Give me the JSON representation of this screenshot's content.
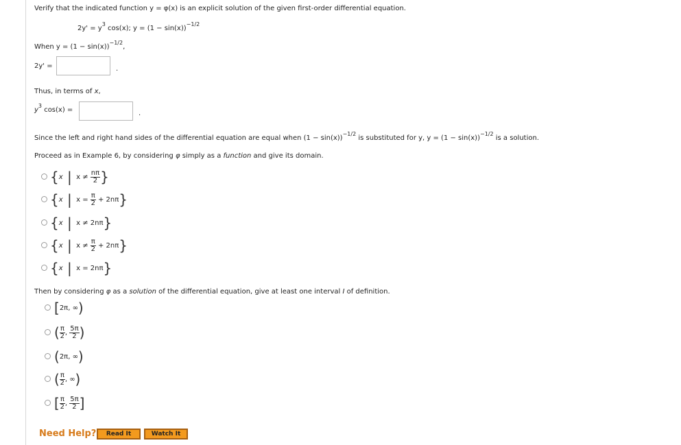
{
  "problem": {
    "statement": "Verify that the indicated function y = φ(x) is an explicit solution of the given first-order differential equation.",
    "equation_lhs": "2y' = y",
    "equation_lhs_exp": "3",
    "equation_rhs": " cos(x);   y = (1 − sin(x))",
    "equation_rhs_exp": "−1/2",
    "when_text": "When y = (1 − sin(x))",
    "when_exp": "−1/2",
    "when_comma": ",",
    "label_2y": "2y' =",
    "period_1": ".",
    "thus_text": "Thus, in terms of ",
    "thus_var": "x",
    "thus_comma": ",",
    "label_y3": "y",
    "label_y3_exp": "3",
    "label_y3_rest": " cos(x) =",
    "period_2": ".",
    "since_text_a": "Since the left and right hand sides of the differential equation are equal when (1 − sin(x))",
    "since_exp_a": "−1/2",
    "since_text_b": " is substituted for y, y = (1 − sin(x))",
    "since_exp_b": "−1/2",
    "since_text_c": " is a solution.",
    "proceed_a": "Proceed as in Example 6, by considering ",
    "proceed_phi": "φ",
    "proceed_b": " simply as a ",
    "proceed_ital": "function",
    "proceed_c": " and give its domain.",
    "then_a": "Then by considering ",
    "then_phi": "φ",
    "then_b": " as a ",
    "then_ital": "solution",
    "then_c": " of the differential equation, give at least one interval ",
    "then_I": "I",
    "then_d": " of definition."
  },
  "inputs": {
    "answer_2y": "",
    "answer_y3": ""
  },
  "domain_options": [
    {
      "x": "x",
      "rel": "x ≠",
      "num": "nπ",
      "den": "2",
      "tail": ""
    },
    {
      "x": "x",
      "rel": "x =",
      "num": "π",
      "den": "2",
      "tail": "+ 2nπ"
    },
    {
      "x": "x",
      "rel": "x ≠ 2nπ",
      "num": "",
      "den": "",
      "tail": ""
    },
    {
      "x": "x",
      "rel": "x ≠",
      "num": "π",
      "den": "2",
      "tail": "+ 2nπ"
    },
    {
      "x": "x",
      "rel": "x = 2nπ",
      "num": "",
      "den": "",
      "tail": ""
    }
  ],
  "interval_options": [
    {
      "open": "[",
      "a": "2π",
      "b": "∞",
      "close": ")"
    },
    {
      "open": "(",
      "a_num": "π",
      "a_den": "2",
      "b_num": "5π",
      "b_den": "2",
      "close": ")"
    },
    {
      "open": "(",
      "a": "2π",
      "b": "∞",
      "close": ")"
    },
    {
      "open": "(",
      "a_num": "π",
      "a_den": "2",
      "b": "∞",
      "close": ")"
    },
    {
      "open": "[",
      "a_num": "π",
      "a_den": "2",
      "b_num": "5π",
      "b_den": "2",
      "close": "]"
    }
  ],
  "help": {
    "label": "Need Help?",
    "read_it": "Read It",
    "watch_it": "Watch It"
  },
  "colors": {
    "help": "#d77b1b",
    "button_bg": "#f39a1e",
    "button_border": "#a65f10"
  }
}
